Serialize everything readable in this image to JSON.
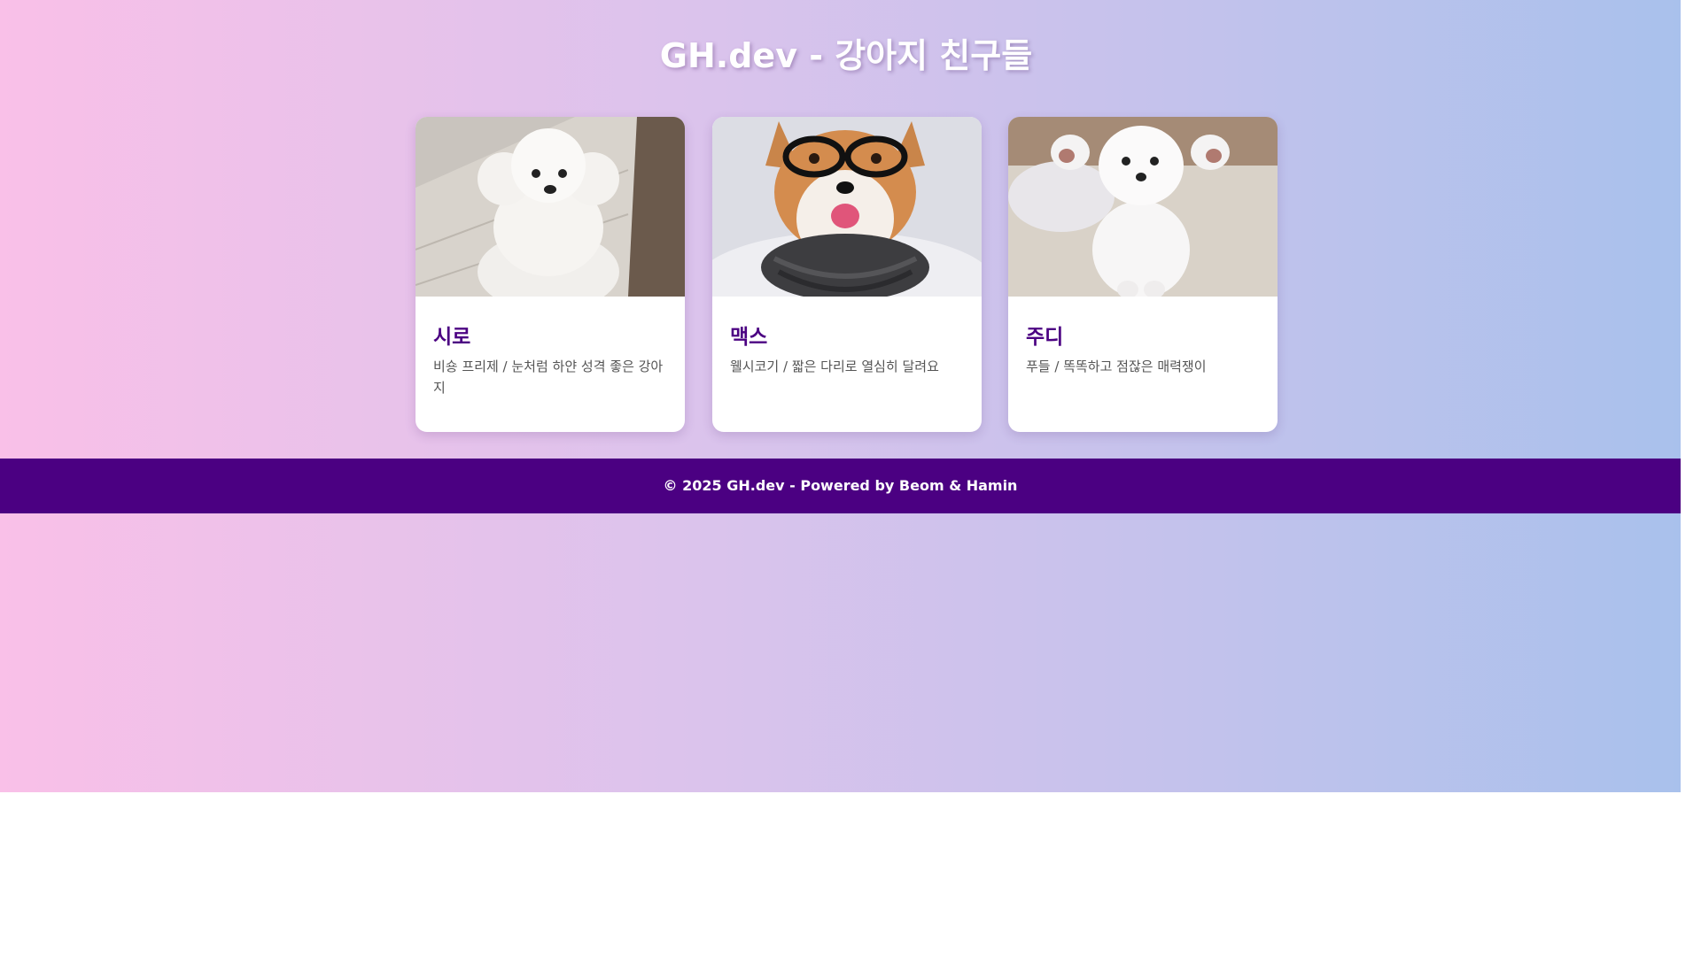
{
  "page": {
    "title": "GH.dev - 강아지 친구들",
    "footer": "© 2025 GH.dev - Powered by Beom & Hamin"
  },
  "dogs": [
    {
      "name": "시로",
      "description": "비숑 프리제 / 눈처럼 하얀 성격 좋은 강아지"
    },
    {
      "name": "맥스",
      "description": "웰시코기 / 짧은 다리로 열심히 달려요"
    },
    {
      "name": "주디",
      "description": "푸들 / 똑똑하고 점잖은 매력쟁이"
    }
  ],
  "colors": {
    "accent": "#4b0082",
    "gradient_start": "#f9c0e8",
    "gradient_end": "#a9c1ec",
    "card_bg": "#ffffff",
    "description_text": "#555555"
  }
}
